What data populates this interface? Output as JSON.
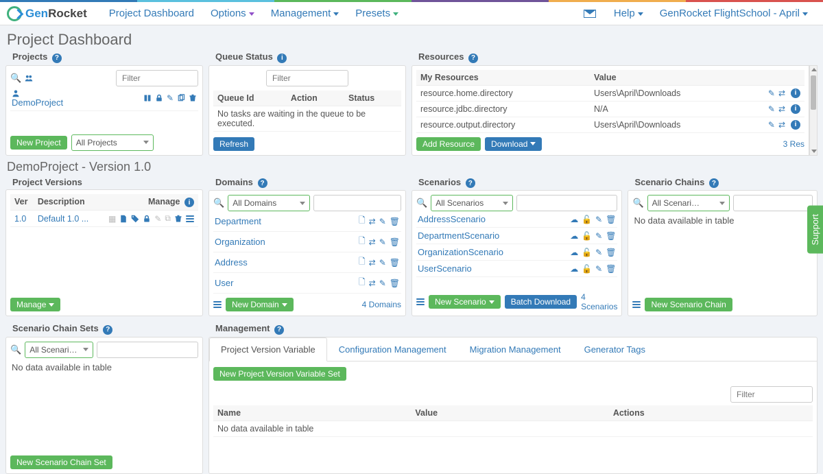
{
  "nav": {
    "brand_gen": "Gen",
    "brand_rocket": "Rocket",
    "dashboard": "Project Dashboard",
    "options": "Options",
    "management": "Management",
    "presets": "Presets",
    "help": "Help",
    "account": "GenRocket FlightSchool - April"
  },
  "page_title": "Project Dashboard",
  "projects": {
    "title": "Projects",
    "filter_ph": "Filter",
    "item": "DemoProject",
    "btn_new": "New Project",
    "dd": "All Projects"
  },
  "queue": {
    "title": "Queue Status",
    "filter_ph": "Filter",
    "h1": "Queue Id",
    "h2": "Action",
    "h3": "Status",
    "empty": "No tasks are waiting in the queue to be executed.",
    "btn": "Refresh"
  },
  "resources": {
    "title": "Resources",
    "h1": "My Resources",
    "h2": "Value",
    "rows": [
      {
        "k": "resource.home.directory",
        "v": "Users\\April\\Downloads"
      },
      {
        "k": "resource.jdbc.directory",
        "v": "N/A"
      },
      {
        "k": "resource.output.directory",
        "v": "Users\\April\\Downloads"
      }
    ],
    "btn_add": "Add Resource",
    "btn_dl": "Download",
    "count": "3 Res"
  },
  "subpage": "DemoProject - Version 1.0",
  "versions": {
    "title": "Project Versions",
    "h1": "Ver",
    "h2": "Description",
    "h3": "Manage",
    "ver": "1.0",
    "desc": "Default 1.0 ...",
    "btn": "Manage"
  },
  "domains": {
    "title": "Domains",
    "dd": "All Domains",
    "items": [
      "Department",
      "Organization",
      "Address",
      "User"
    ],
    "btn": "New Domain",
    "count": "4 Domains"
  },
  "scenarios": {
    "title": "Scenarios",
    "dd": "All Scenarios",
    "items": [
      "AddressScenario",
      "DepartmentScenario",
      "OrganizationScenario",
      "UserScenario"
    ],
    "btn_new": "New Scenario",
    "btn_batch": "Batch Download",
    "count": "4 Scenarios"
  },
  "chains": {
    "title": "Scenario Chains",
    "dd": "All Scenari…",
    "empty": "No data available in table",
    "btn": "New Scenario Chain"
  },
  "chainsets": {
    "title": "Scenario Chain Sets",
    "dd": "All Scenari…",
    "empty": "No data available in table",
    "btn": "New Scenario Chain Set"
  },
  "mgmt": {
    "title": "Management",
    "tabs": [
      "Project Version Variable",
      "Configuration Management",
      "Migration Management",
      "Generator Tags"
    ],
    "btn": "New Project Version Variable Set",
    "filter_ph": "Filter",
    "h1": "Name",
    "h2": "Value",
    "h3": "Actions",
    "empty": "No data available in table"
  },
  "support": "Support"
}
